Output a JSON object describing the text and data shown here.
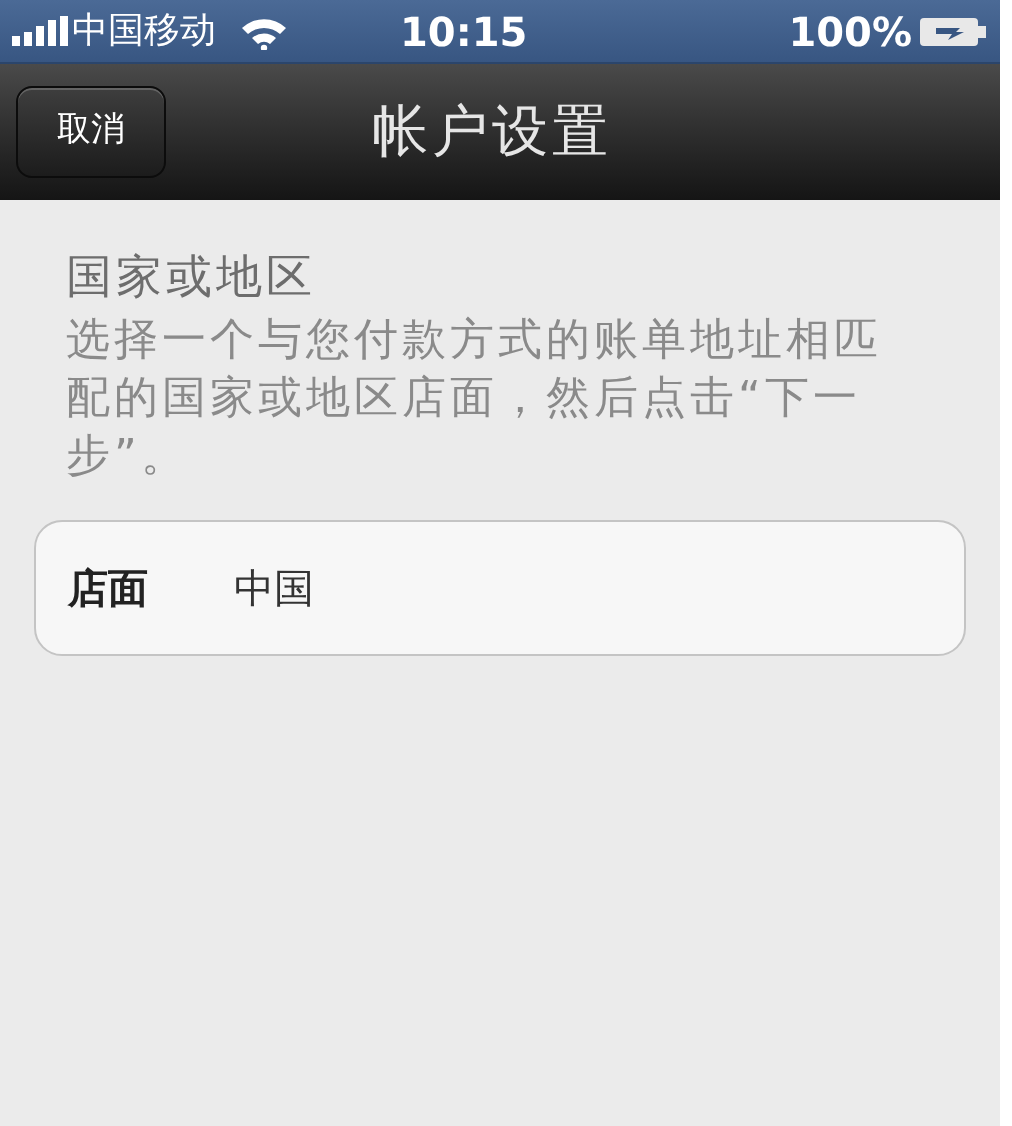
{
  "status_bar": {
    "carrier": "中国移动",
    "time": "10:15",
    "battery": "100%"
  },
  "nav_bar": {
    "title": "帐户设置",
    "cancel_button": "取消"
  },
  "section": {
    "title": "国家或地区",
    "description": "选择一个与您付款方式的账单地址相匹配的国家或地区店面，然后点击“下一步”。"
  },
  "rows": [
    {
      "label": "店面",
      "value": "中国"
    }
  ]
}
